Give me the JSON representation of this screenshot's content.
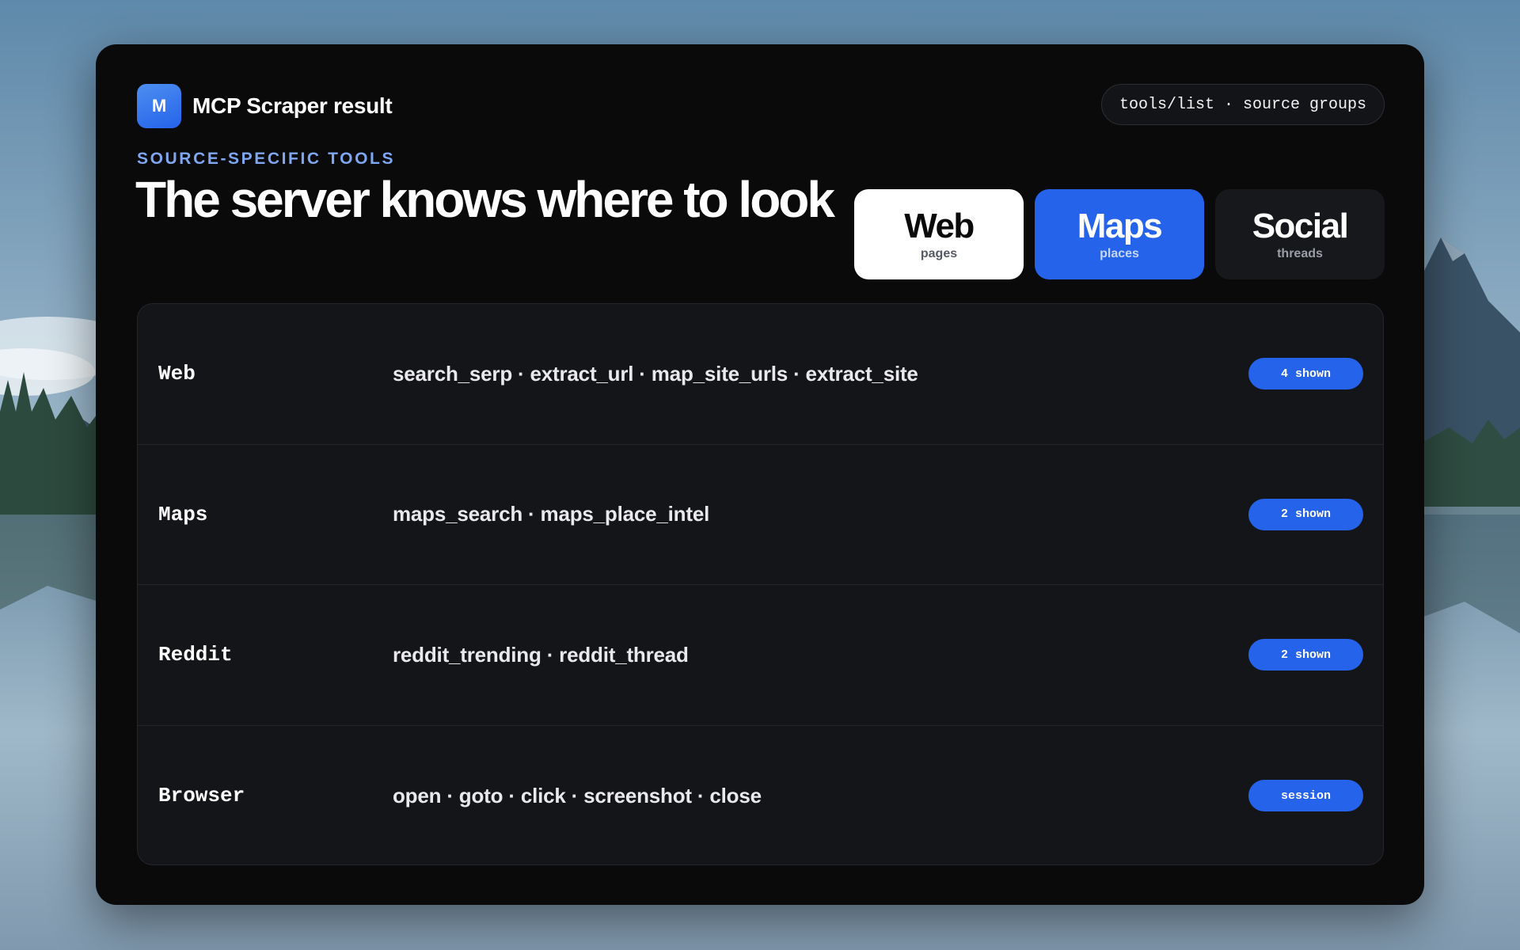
{
  "colors": {
    "window_bg": "#0a0a0b",
    "accent": "#2563eb",
    "eyebrow": "#7fa6f0",
    "table_bg": "#141519"
  },
  "app": {
    "logo_letter": "M",
    "title": "MCP Scraper result"
  },
  "status_pill": "tools/list · source groups",
  "hero": {
    "eyebrow": "SOURCE-SPECIFIC TOOLS",
    "headline": "The server knows where to look"
  },
  "cards": [
    {
      "title": "Web",
      "subtitle": "pages"
    },
    {
      "title": "Maps",
      "subtitle": "places"
    },
    {
      "title": "Social",
      "subtitle": "threads"
    }
  ],
  "tool_groups": [
    {
      "name": "Web",
      "tools": "search_serp · extract_url · map_site_urls · extract_site",
      "badge": "4 shown"
    },
    {
      "name": "Maps",
      "tools": "maps_search · maps_place_intel",
      "badge": "2 shown"
    },
    {
      "name": "Reddit",
      "tools": "reddit_trending · reddit_thread",
      "badge": "2 shown"
    },
    {
      "name": "Browser",
      "tools": "open · goto · click · screenshot · close",
      "badge": "session"
    }
  ]
}
